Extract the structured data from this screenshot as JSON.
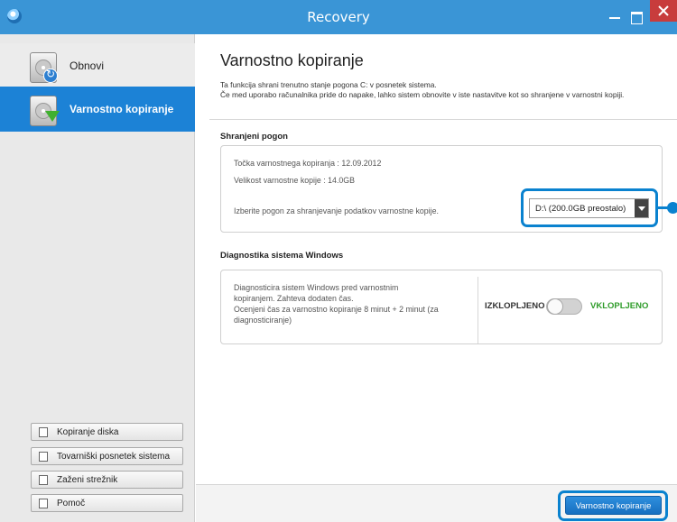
{
  "window": {
    "title": "Recovery"
  },
  "sidebar": {
    "items": [
      {
        "label": "Obnovi",
        "icon": "restore-icon",
        "selected": false
      },
      {
        "label": "Varnostno kopiranje",
        "icon": "backup-icon",
        "selected": true
      }
    ],
    "bottom_buttons": [
      {
        "label": "Kopiranje diska",
        "icon": "disk-copy-icon"
      },
      {
        "label": "Tovarniški posnetek sistema",
        "icon": "factory-image-icon"
      },
      {
        "label": "Zaženi strežnik",
        "icon": "server-icon"
      },
      {
        "label": "Pomoč",
        "icon": "help-icon"
      }
    ]
  },
  "main": {
    "title": "Varnostno kopiranje",
    "description_line1": "Ta funkcija shrani trenutno stanje pogona C: v posnetek sistema.",
    "description_line2": "Če med uporabo računalnika pride do napake, lahko sistem obnovite v iste nastavitve kot so shranjene v varnostni kopiji.",
    "saved_drive": {
      "section_title": "Shranjeni pogon",
      "backup_point": "Točka varnostnega kopiranja : 12.09.2012",
      "backup_size": "Velikost varnostne kopije : 14.0GB",
      "select_prompt": "Izberite pogon za shranjevanje podatkov varnostne kopije.",
      "selected_drive": "D:\\ (200.0GB preostalo)"
    },
    "diagnostics": {
      "section_title": "Diagnostika sistema Windows",
      "line1": "Diagnosticira sistem Windows pred varnostnim",
      "line2": "kopiranjem. Zahteva dodaten čas.",
      "line3": "Ocenjeni čas za varnostno kopiranje 8 minut + 2 minut (za",
      "line4": "diagnosticiranje)",
      "off_label": "IZKLOPLJENO",
      "on_label": "VKLOPLJENO",
      "toggle_state": "off"
    },
    "action_button": "Varnostno kopiranje"
  },
  "colors": {
    "titlebar": "#3a95d6",
    "selected_nav": "#1c82d6",
    "highlight": "#0a82cf",
    "on_label": "#2f9c2a",
    "close_button": "#c83c3c"
  }
}
